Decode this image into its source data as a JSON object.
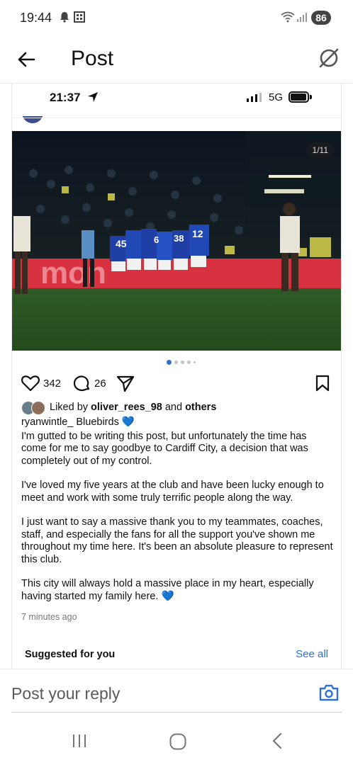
{
  "status_bar": {
    "time": "19:44",
    "battery": "86",
    "icons": [
      "bell-icon",
      "grid-icon",
      "wifi-icon",
      "signal-icon"
    ]
  },
  "header": {
    "title": "Post",
    "back_icon": "arrow-left-icon",
    "action_icon": "grok-slash-icon"
  },
  "embedded_post": {
    "status": {
      "time": "21:37",
      "network": "5G"
    },
    "photo": {
      "counter": "1/11",
      "ad_board_text": "mon"
    },
    "carousel": {
      "active_index": 0,
      "dots": 5
    },
    "actions": {
      "like_count": "342",
      "comment_count": "26",
      "icons": [
        "heart-icon",
        "comment-icon",
        "send-icon",
        "bookmark-icon"
      ]
    },
    "liked_by": {
      "prefix": "Liked by ",
      "user": "oliver_rees_98",
      "middle": " and ",
      "others": "others"
    },
    "caption": {
      "username": "ryanwintle_",
      "first_line": "Bluebirds",
      "emoji": "💙",
      "paragraphs": [
        "I'm gutted to be writing this post, but unfortunately the time has come for me to say goodbye to Cardiff City, a decision that was completely out of my control.",
        "I've loved my five years at the club and have been lucky enough to meet and work with some truly terrific people along the way.",
        "I just want to say a massive thank you to my teammates, coaches, staff, and especially the fans for all the support you've shown me throughout my time here. It's been an absolute pleasure to represent this club.",
        "This city will always hold a massive place in my heart, especially having started my family here."
      ]
    },
    "time_ago": "7 minutes ago",
    "suggested": {
      "title": "Suggested for you",
      "see_all": "See all"
    }
  },
  "reply": {
    "placeholder": "Post your reply",
    "icon": "camera-icon"
  },
  "nav": {
    "icons": [
      "recents-icon",
      "home-icon",
      "back-icon"
    ]
  },
  "colors": {
    "accent": "#2f6fd8",
    "heart_blue": "#2d6fd6",
    "pitch_green": "#2f5a26",
    "ad_red": "#d8313f"
  }
}
